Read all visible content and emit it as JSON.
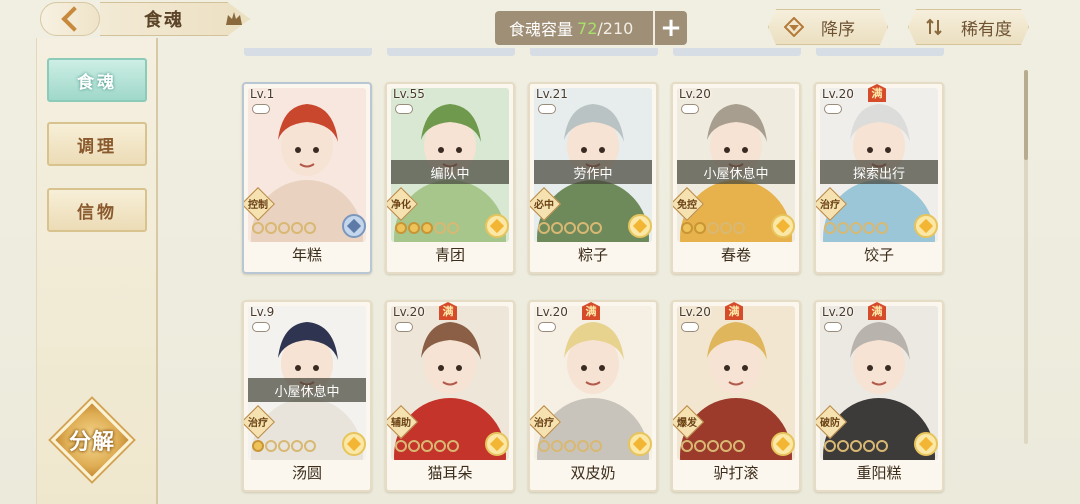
{
  "header": {
    "title": "食魂",
    "capacity_label": "食魂容量",
    "capacity_current": "72",
    "capacity_max": "/210",
    "add_label": "+",
    "sort_order_label": "降序",
    "sort_rarity_label": "稀有度"
  },
  "sidebar": {
    "items": [
      {
        "label": "食魂"
      },
      {
        "label": "调理"
      },
      {
        "label": "信物"
      }
    ],
    "decompose_label": "分解"
  },
  "cards": [
    {
      "level": "Lv.1",
      "name": "年糕",
      "status": "",
      "role": "控制",
      "stars": 0,
      "quality": "blue",
      "maxed": false,
      "palette": [
        "#f7e7df",
        "#c9472d",
        "#e9d3c0"
      ]
    },
    {
      "level": "Lv.55",
      "name": "青团",
      "status": "编队中",
      "role": "净化",
      "stars": 3,
      "quality": "gold",
      "maxed": false,
      "palette": [
        "#d9e8d2",
        "#6f9a4d",
        "#a6c68b"
      ]
    },
    {
      "level": "Lv.21",
      "name": "粽子",
      "status": "劳作中",
      "role": "必中",
      "stars": 0,
      "quality": "gold",
      "maxed": false,
      "palette": [
        "#e7ecec",
        "#b9c3c4",
        "#6e8a5b"
      ]
    },
    {
      "level": "Lv.20",
      "name": "春卷",
      "status": "小屋休息中",
      "role": "免控",
      "stars": 2,
      "quality": "gold",
      "maxed": false,
      "palette": [
        "#f0ebdf",
        "#a89e8f",
        "#e7b24c"
      ]
    },
    {
      "level": "Lv.20",
      "name": "饺子",
      "status": "探索出行",
      "role": "治疗",
      "stars": 0,
      "quality": "gold",
      "maxed": true,
      "palette": [
        "#f0eeea",
        "#dcdcda",
        "#9ac6d8"
      ]
    },
    {
      "level": "Lv.9",
      "name": "汤圆",
      "status": "小屋休息中",
      "role": "治疗",
      "stars": 1,
      "quality": "gold",
      "maxed": false,
      "palette": [
        "#f4f2ee",
        "#2f3550",
        "#e8e4dc"
      ]
    },
    {
      "level": "Lv.20",
      "name": "猫耳朵",
      "status": "",
      "role": "辅助",
      "stars": 0,
      "quality": "gold",
      "maxed": true,
      "palette": [
        "#efe6da",
        "#8a5f45",
        "#c4342a"
      ]
    },
    {
      "level": "Lv.20",
      "name": "双皮奶",
      "status": "",
      "role": "治疗",
      "stars": 0,
      "quality": "gold",
      "maxed": true,
      "palette": [
        "#f5efe4",
        "#e7d28e",
        "#c9c4bb"
      ]
    },
    {
      "level": "Lv.20",
      "name": "驴打滚",
      "status": "",
      "role": "爆发",
      "stars": 0,
      "quality": "gold",
      "maxed": true,
      "palette": [
        "#f2e6d0",
        "#e0b65c",
        "#9c3b2c"
      ]
    },
    {
      "level": "Lv.20",
      "name": "重阳糕",
      "status": "",
      "role": "破防",
      "stars": 0,
      "quality": "gold",
      "maxed": true,
      "palette": [
        "#ece8e2",
        "#b9b3ad",
        "#3d3a3a"
      ]
    }
  ],
  "colors": {
    "accent_teal": "#9fd8c9",
    "capacity_green": "#a8e06c",
    "gold": "#eec35a",
    "max_badge_red": "#d64b2a"
  },
  "max_badge_text": "满"
}
